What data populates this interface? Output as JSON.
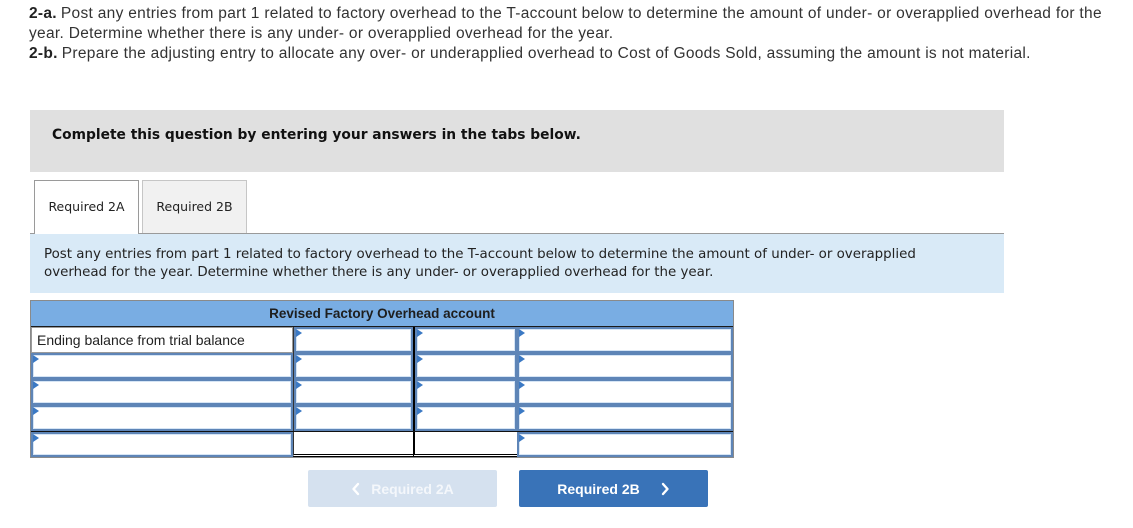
{
  "instructions": {
    "part_a": {
      "label": "2-a.",
      "text": "Post any entries from part 1 related to factory overhead to the T-account below to determine the amount of under- or overapplied overhead for the year. Determine whether there is any under- or overapplied overhead for the year."
    },
    "part_b": {
      "label": "2-b.",
      "text": "Prepare the adjusting entry to allocate any over- or underapplied overhead to Cost of Goods Sold, assuming the amount is not material."
    }
  },
  "banner": {
    "text": "Complete this question by entering your answers in the tabs below."
  },
  "tabs": [
    {
      "label": "Required 2A",
      "active": true
    },
    {
      "label": "Required 2B",
      "active": false
    }
  ],
  "tab_panel": {
    "instruction": "Post any entries from part 1 related to factory overhead to the T-account below to determine the amount of under- or overapplied overhead for the year. Determine whether there is any under- or overapplied overhead for the year."
  },
  "t_account": {
    "title": "Revised Factory Overhead account",
    "rows": [
      {
        "debit_label": "Ending balance from trial balance",
        "debit_amount": "",
        "credit_amount": "",
        "credit_label": ""
      },
      {
        "debit_label": "",
        "debit_amount": "",
        "credit_amount": "",
        "credit_label": ""
      },
      {
        "debit_label": "",
        "debit_amount": "",
        "credit_amount": "",
        "credit_label": ""
      },
      {
        "debit_label": "",
        "debit_amount": "",
        "credit_amount": "",
        "credit_label": ""
      },
      {
        "debit_label": "",
        "debit_total": "",
        "credit_total": "",
        "credit_label": ""
      }
    ]
  },
  "navigation": {
    "prev": {
      "label": "Required 2A",
      "icon": "chevron-left",
      "disabled": true
    },
    "next": {
      "label": "Required 2B",
      "icon": "chevron-right",
      "disabled": false
    }
  },
  "colors": {
    "header_blue": "#79ade3",
    "panel_blue": "#d9eaf7",
    "banner_gray": "#e0e0e0",
    "button_blue": "#3973b8",
    "button_disabled": "#d5e1ef",
    "input_border": "#5e85b7"
  }
}
